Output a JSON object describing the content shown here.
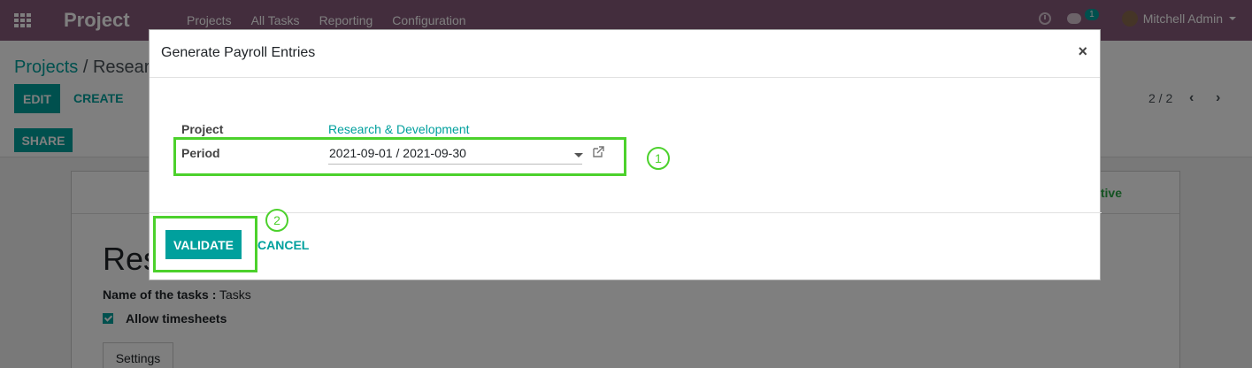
{
  "navbar": {
    "brand": "Project",
    "menu": [
      "Projects",
      "All Tasks",
      "Reporting",
      "Configuration"
    ],
    "chat_count": "1",
    "user_name": "Mitchell Admin"
  },
  "control_panel": {
    "breadcrumb_root": "Projects",
    "breadcrumb_sep": "/",
    "breadcrumb_current": "Resear",
    "edit_label": "EDIT",
    "create_label": "CREATE",
    "share_label": "SHARE",
    "pager": "2 / 2"
  },
  "sheet": {
    "status_text": "tive",
    "title": "Res",
    "tasks_label": "Name of the tasks :",
    "tasks_value": "Tasks",
    "allow_timesheets_label": "Allow timesheets",
    "settings_tab": "Settings"
  },
  "modal": {
    "title": "Generate Payroll Entries",
    "close": "×",
    "project_label": "Project",
    "project_value": "Research & Development",
    "period_label": "Period",
    "period_value": "2021-09-01 / 2021-09-30",
    "validate_label": "VALIDATE",
    "cancel_label": "CANCEL"
  },
  "annotations": {
    "step1": "1",
    "step2": "2",
    "color": "#4cd12c"
  },
  "colors": {
    "navbar": "#875a7b",
    "accent": "#00a09d"
  }
}
